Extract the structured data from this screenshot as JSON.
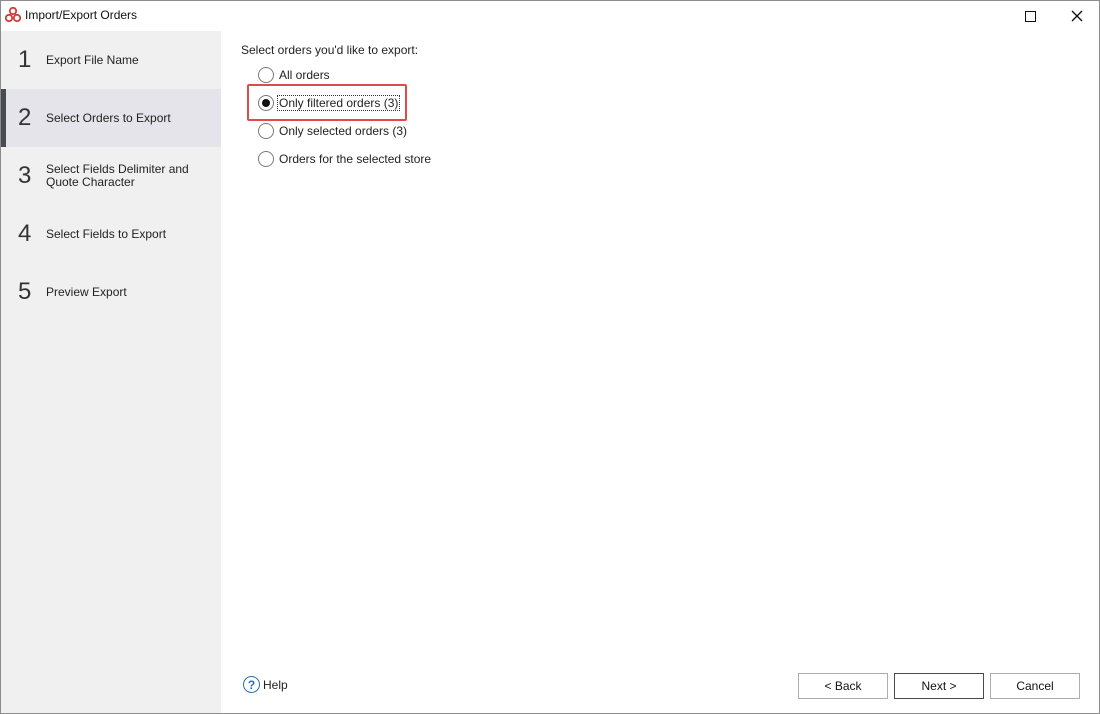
{
  "window": {
    "title": "Import/Export Orders",
    "app_icon": "shipping-app-icon",
    "maximize_icon": "maximize-icon",
    "close_icon": "close-icon",
    "close_glyph": "✕"
  },
  "steps": [
    {
      "num": "1",
      "label": "Export File Name",
      "active": false
    },
    {
      "num": "2",
      "label": "Select Orders to Export",
      "active": true
    },
    {
      "num": "3",
      "label": "Select Fields Delimiter and Quote Character",
      "active": false
    },
    {
      "num": "4",
      "label": "Select Fields to Export",
      "active": false
    },
    {
      "num": "5",
      "label": "Preview Export",
      "active": false
    }
  ],
  "main": {
    "prompt": "Select orders you'd like to export:",
    "options": [
      {
        "label": "All orders",
        "checked": false
      },
      {
        "label": "Only filtered orders (3)",
        "checked": true
      },
      {
        "label": "Only selected orders (3)",
        "checked": false
      },
      {
        "label": "Orders for the selected store",
        "checked": false
      }
    ],
    "highlight_color": "#e04a4a"
  },
  "footer": {
    "help_label": "Help",
    "help_glyph": "?",
    "back_label": "< Back",
    "next_label": "Next >",
    "cancel_label": "Cancel"
  }
}
